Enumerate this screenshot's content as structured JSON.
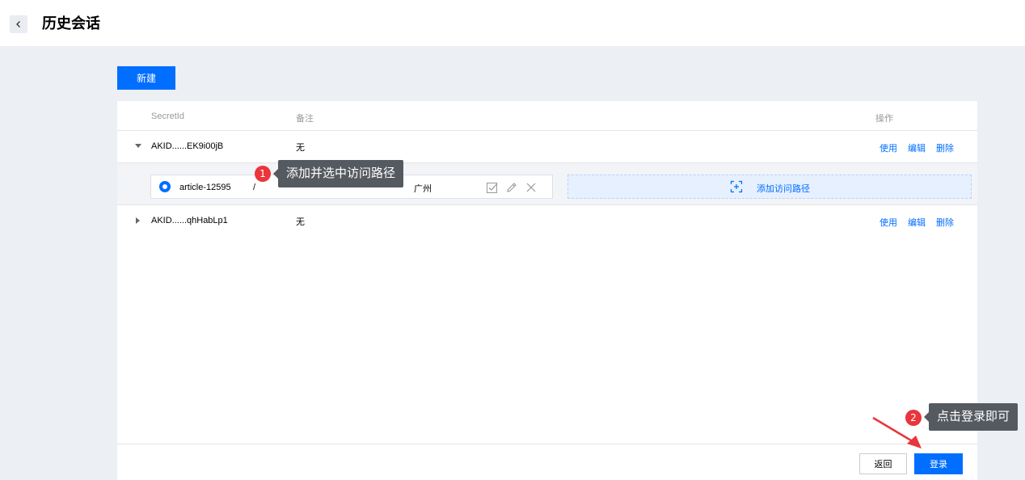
{
  "header": {
    "title": "历史会话",
    "back_icon": "chevron-left-icon"
  },
  "toolbar": {
    "new_label": "新建"
  },
  "table": {
    "columns": [
      "SecretId",
      "备注",
      "操作"
    ],
    "rows": [
      {
        "secret": "AKID......EK9i00jB",
        "remark": "无",
        "expanded": true,
        "ops": [
          "使用",
          "编辑",
          "删除"
        ],
        "paths": [
          {
            "name": "article-12595",
            "path": "/",
            "region": "广州",
            "selected": true
          }
        ],
        "add_path_label": "添加访问路径"
      },
      {
        "secret": "AKID......qhHabLp1",
        "remark": "无",
        "expanded": false,
        "ops": [
          "使用",
          "编辑",
          "删除"
        ]
      }
    ]
  },
  "footer": {
    "back_label": "返回",
    "login_label": "登录"
  },
  "annotations": [
    {
      "num": "1",
      "text": "添加并选中访问路径"
    },
    {
      "num": "2",
      "text": "点击登录即可"
    }
  ],
  "colors": {
    "accent": "#006eff",
    "badge": "#e9353b",
    "tooltip": "#555a60"
  }
}
